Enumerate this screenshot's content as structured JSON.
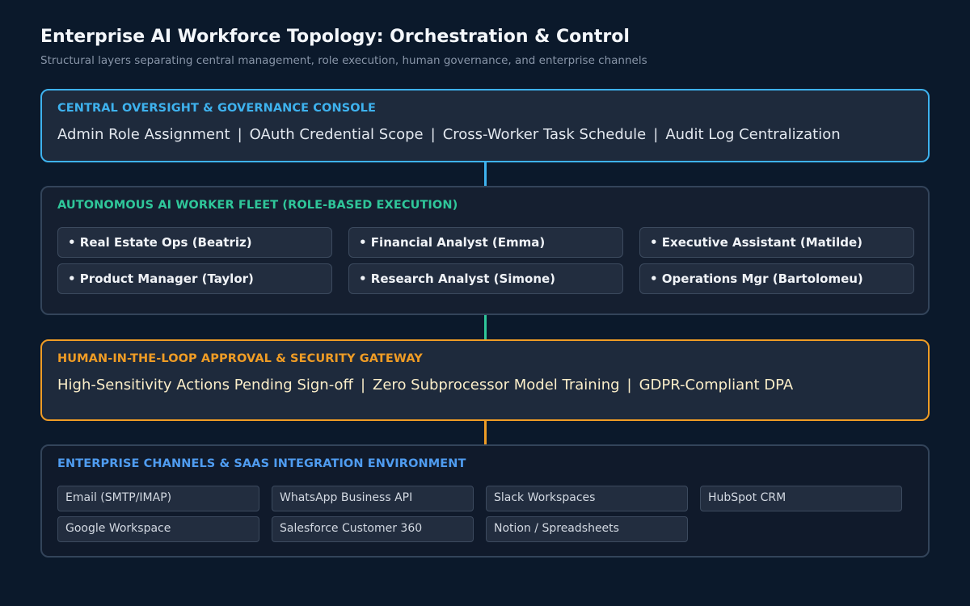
{
  "title": "Enterprise AI Workforce Topology: Orchestration & Control",
  "subtitle": "Structural layers separating central management, role execution, human governance, and enterprise channels",
  "separator": "|",
  "layers": {
    "oversight": {
      "heading": "CENTRAL OVERSIGHT & GOVERNANCE CONSOLE",
      "items": [
        "Admin Role Assignment",
        "OAuth Credential Scope",
        "Cross-Worker Task Schedule",
        "Audit Log Centralization"
      ],
      "color": "#3eb2ee"
    },
    "fleet": {
      "heading": "AUTONOMOUS AI WORKER FLEET (ROLE-BASED EXECUTION)",
      "workers": [
        "• Real Estate Ops (Beatriz)",
        "• Financial Analyst (Emma)",
        "• Executive Assistant (Matilde)",
        "• Product Manager (Taylor)",
        "• Research Analyst (Simone)",
        "• Operations Mgr (Bartolomeu)"
      ],
      "color": "#2fc79a"
    },
    "gateway": {
      "heading": "HUMAN-IN-THE-LOOP APPROVAL & SECURITY GATEWAY",
      "items": [
        "High-Sensitivity Actions Pending Sign-off",
        "Zero Subprocessor Model Training",
        "GDPR-Compliant DPA"
      ],
      "color": "#ef9c25"
    },
    "channels": {
      "heading": "ENTERPRISE CHANNELS & SAAS INTEGRATION ENVIRONMENT",
      "items": [
        "Email (SMTP/IMAP)",
        "WhatsApp Business API",
        "Slack Workspaces",
        "HubSpot CRM",
        "Google Workspace",
        "Salesforce Customer 360",
        "Notion / Spreadsheets"
      ],
      "color": "#4f9cf0"
    }
  }
}
